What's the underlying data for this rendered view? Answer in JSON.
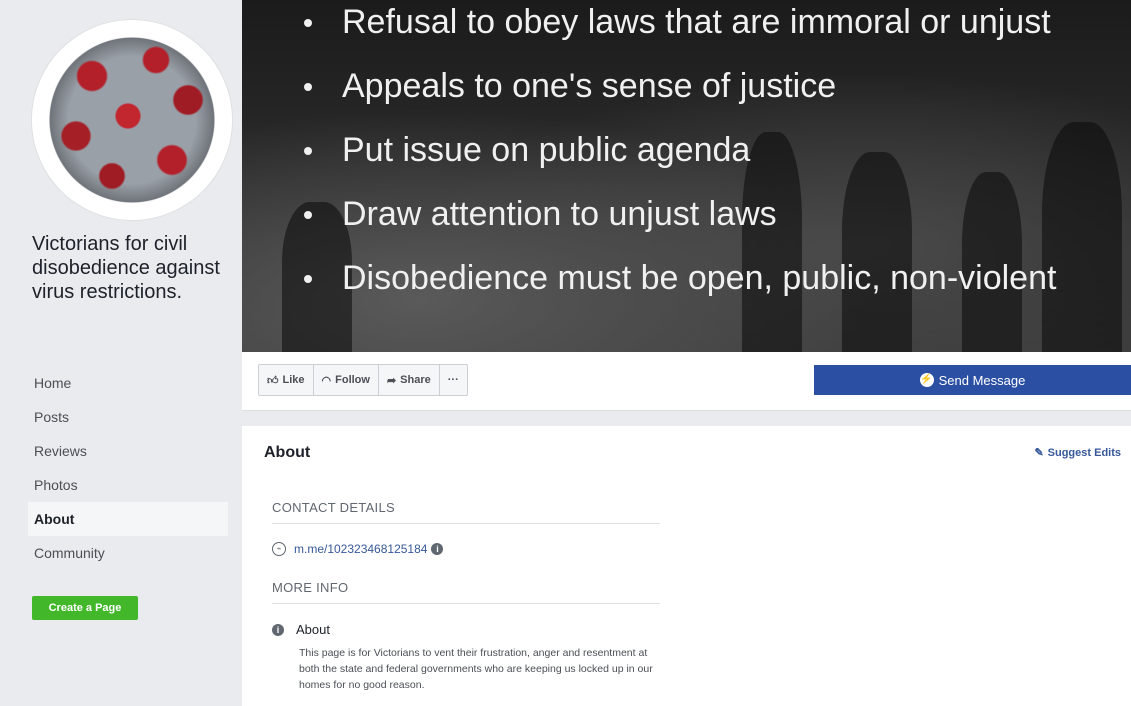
{
  "page": {
    "name": "Victorians for civil disobedience against virus restrictions."
  },
  "cover": {
    "bullets": [
      "Refusal to obey laws that are immoral or unjust",
      "Appeals to one's sense of justice",
      "Put issue on public agenda",
      "Draw attention to unjust laws",
      "Disobedience must be open, public, non-violent"
    ]
  },
  "nav": {
    "items": [
      "Home",
      "Posts",
      "Reviews",
      "Photos",
      "About",
      "Community"
    ],
    "active": "About",
    "create_page": "Create a Page"
  },
  "actions": {
    "like": "Like",
    "follow": "Follow",
    "share": "Share",
    "more": "···",
    "send_message": "Send Message"
  },
  "about": {
    "title": "About",
    "suggest_edits": "Suggest Edits",
    "contact_heading": "CONTACT DETAILS",
    "messenger_link": "m.me/102323468125184",
    "more_info_heading": "MORE INFO",
    "about_label": "About",
    "description": "This page is for Victorians to vent their frustration, anger and resentment at both the state and federal governments who are keeping us locked up in our homes for no good reason."
  },
  "colors": {
    "accent": "#2b4fa2",
    "link": "#365899",
    "create_button": "#42b72a",
    "background": "#e9ebee"
  }
}
